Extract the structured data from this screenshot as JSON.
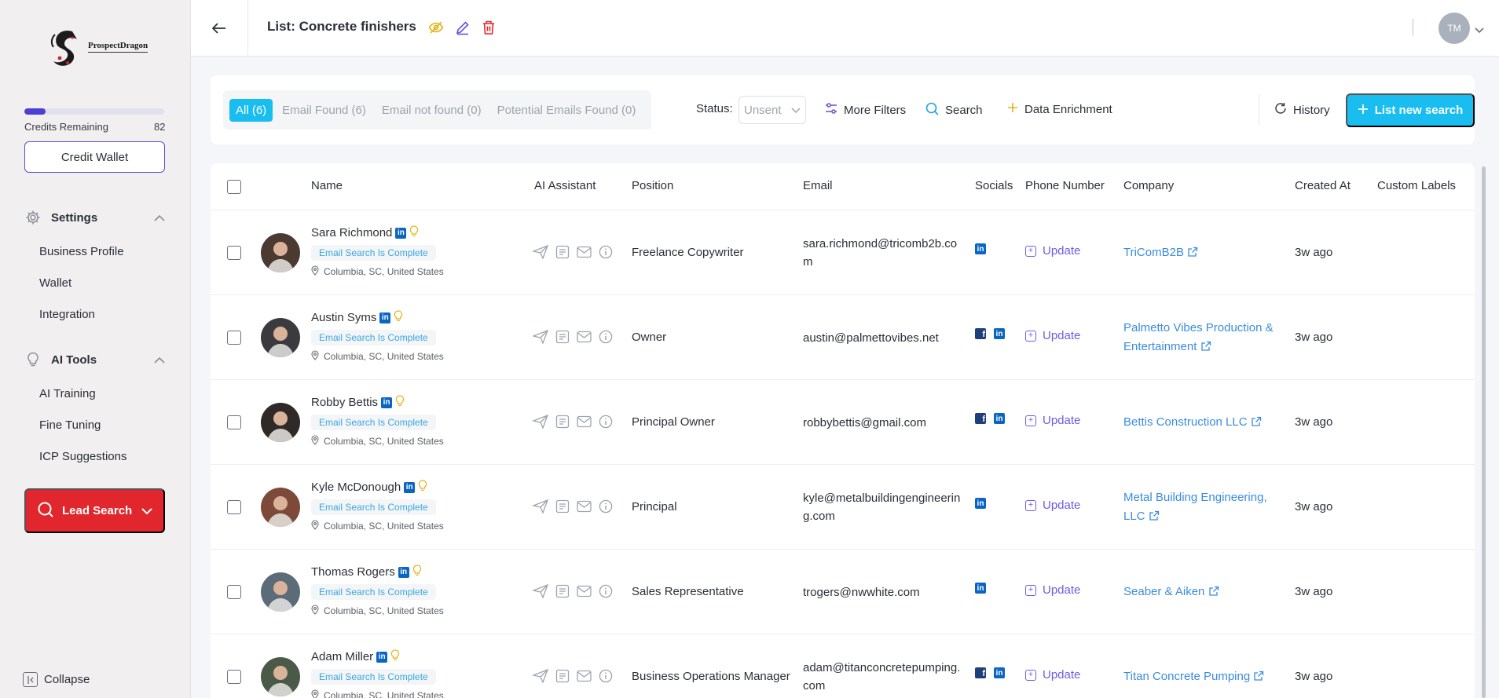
{
  "sidebar": {
    "logo_text": "ProspectDragon",
    "credits_label": "Credits Remaining",
    "credits_value": "82",
    "credits_fraction": 0.15,
    "wallet_button": "Credit Wallet",
    "settings": {
      "label": "Settings",
      "items": [
        "Business Profile",
        "Wallet",
        "Integration"
      ]
    },
    "ai_tools": {
      "label": "AI Tools",
      "items": [
        "AI Training",
        "Fine Tuning",
        "ICP Suggestions"
      ]
    },
    "lead_search": "Lead Search",
    "collapse": "Collapse"
  },
  "topbar": {
    "title": "List: Concrete finishers",
    "avatar_initials": "TM"
  },
  "filters": {
    "tabs": [
      "All (6)",
      "Email Found (6)",
      "Email not found (0)",
      "Potential Emails Found (0)"
    ],
    "status_label": "Status:",
    "status_value": "Unsent",
    "more_filters": "More Filters",
    "search": "Search",
    "data_enrichment": "Data Enrichment",
    "history": "History",
    "list_new_search": "List new search"
  },
  "table": {
    "columns": {
      "name": "Name",
      "ai_assistant": "AI Assistant",
      "position": "Position",
      "email": "Email",
      "socials": "Socials",
      "phone": "Phone Number",
      "company": "Company",
      "created": "Created At",
      "labels": "Custom Labels"
    },
    "badge_text": "Email Search Is Complete",
    "update_text": "Update",
    "rows": [
      {
        "name": "Sara Richmond",
        "location": "Columbia, SC, United States",
        "position": "Freelance Copywriter",
        "email": "sara.richmond@tricomb2b.com",
        "facebook": false,
        "company": "TriComB2B",
        "created": "3w ago",
        "avatar_color": "#4a3a32"
      },
      {
        "name": "Austin Syms",
        "location": "Columbia, SC, United States",
        "position": "Owner",
        "email": "austin@palmettovibes.net",
        "facebook": true,
        "company": "Palmetto Vibes Production & Entertainment",
        "created": "3w ago",
        "avatar_color": "#3b3b3f"
      },
      {
        "name": "Robby Bettis",
        "location": "Columbia, SC, United States",
        "position": "Principal Owner",
        "email": "robbybettis@gmail.com",
        "facebook": true,
        "company": "Bettis Construction LLC",
        "created": "3w ago",
        "avatar_color": "#2f2a27"
      },
      {
        "name": "Kyle McDonough",
        "location": "Columbia, SC, United States",
        "position": "Principal",
        "email": "kyle@metalbuildingengineering.com",
        "facebook": false,
        "company": "Metal Building Engineering, LLC",
        "created": "3w ago",
        "avatar_color": "#7d4a3a"
      },
      {
        "name": "Thomas Rogers",
        "location": "Columbia, SC, United States",
        "position": "Sales Representative",
        "email": "trogers@nwwhite.com",
        "facebook": false,
        "company": "Seaber & Aiken",
        "created": "3w ago",
        "avatar_color": "#5b6b78"
      },
      {
        "name": "Adam Miller",
        "location": "Columbia, SC, United States",
        "position": "Business Operations Manager",
        "email": "adam@titanconcretepumping.com",
        "facebook": true,
        "company": "Titan Concrete Pumping",
        "created": "3w ago",
        "avatar_color": "#4b5a48"
      }
    ]
  }
}
